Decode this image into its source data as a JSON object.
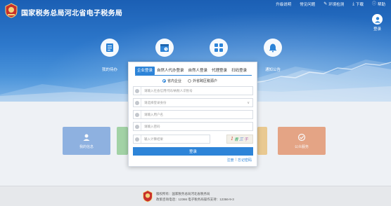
{
  "header": {
    "title": "国家税务总局河北省电子税务局",
    "nav": [
      {
        "icon": "upgrade-icon",
        "label": "升级说明"
      },
      {
        "icon": "faq-icon",
        "label": "常见问题"
      },
      {
        "icon": "env-check-icon",
        "label": "环境检测"
      },
      {
        "icon": "download-icon",
        "label": "下载"
      },
      {
        "icon": "help-icon",
        "label": "帮助"
      }
    ],
    "login_label": "登录"
  },
  "hero": {
    "items": [
      {
        "label": "我的待办",
        "icon": "todo-icon"
      },
      {
        "label": "",
        "icon": "calendar-icon"
      },
      {
        "label": "",
        "icon": "apps-icon"
      },
      {
        "label": "通知公告",
        "icon": "bell-icon"
      }
    ]
  },
  "tiles": [
    {
      "label": "我的信息",
      "color": "#5b8fd6"
    },
    {
      "label": "",
      "color": "#79c27a"
    },
    {
      "label": "",
      "color": "#e6b45a"
    },
    {
      "label": "公众服务",
      "color": "#e07b4a"
    }
  ],
  "login": {
    "tabs": [
      "企业登录",
      "自然人代办登录",
      "自然人登录",
      "代理登录",
      "扫码登录"
    ],
    "active_tab": 0,
    "radios": [
      {
        "label": "省内企业",
        "checked": true
      },
      {
        "label": "外省跨区税源户",
        "checked": false
      }
    ],
    "fields": {
      "credit_code_placeholder": "请输入社会信用代码/纳税人识别号",
      "identity_placeholder": "请选择登录身份",
      "username_placeholder": "请输入用户名",
      "password_placeholder": "请输入密码",
      "captcha_placeholder": "输入计算结果"
    },
    "captcha_text": [
      "1",
      "青",
      "三",
      "千"
    ],
    "submit_label": "登录",
    "register_label": "注册",
    "forgot_label": "忘记密码",
    "link_separator": "|"
  },
  "footer": {
    "line1": "版权所有：国家税务总局河北省税务局",
    "line2": "政策咨询电话：12366 电子税务局操作支持：12366-9-3"
  },
  "colors": {
    "primary": "#2d84d8",
    "hero_top": "#1b5fb4"
  }
}
